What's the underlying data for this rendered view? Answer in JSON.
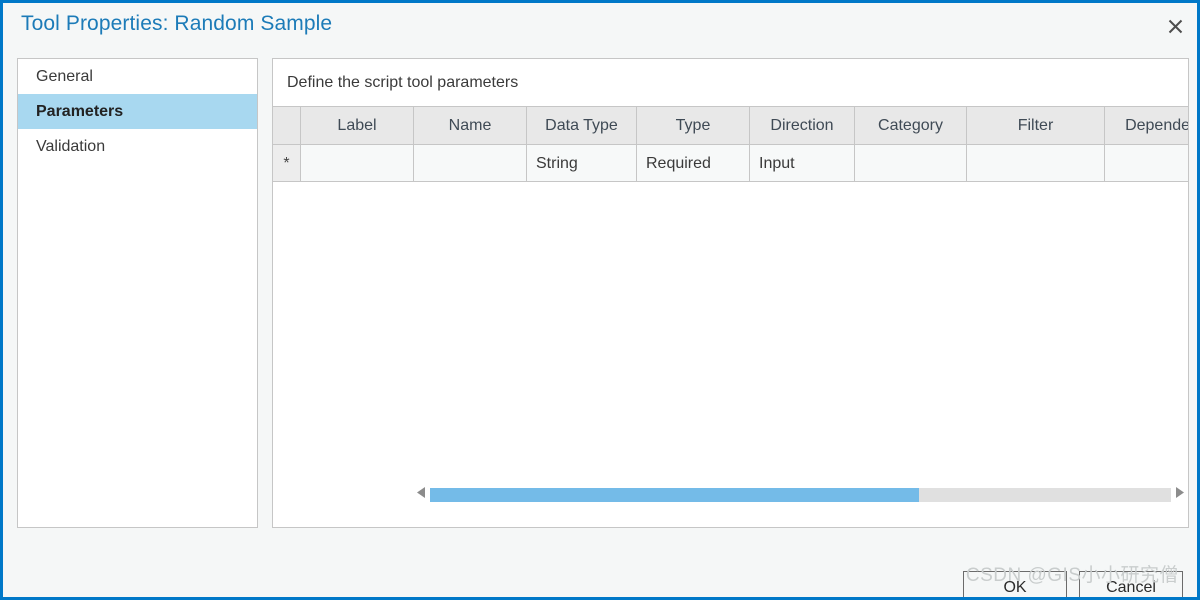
{
  "window": {
    "title": "Tool Properties: Random Sample",
    "close_icon": "close-icon",
    "accent_color": "#0078c8",
    "title_color": "#1c7bb8",
    "background_color": "#f5f7f7"
  },
  "sidebar": {
    "items": [
      {
        "label": "General",
        "selected": false
      },
      {
        "label": "Parameters",
        "selected": true
      },
      {
        "label": "Validation",
        "selected": false
      }
    ],
    "selected_color": "#a8d8f0"
  },
  "main": {
    "header": "Define the script tool parameters",
    "grid": {
      "row_marker_header": "",
      "columns": [
        "Label",
        "Name",
        "Data Type",
        "Type",
        "Direction",
        "Category",
        "Filter",
        "Dependen"
      ],
      "rows": [
        {
          "marker": "*",
          "label": "",
          "name": "",
          "data_type": "String",
          "type": "Required",
          "direction": "Input",
          "category": "",
          "filter": "",
          "dependency": ""
        }
      ]
    },
    "scrollbar": {
      "left_arrow_icon": "triangle-left-icon",
      "right_arrow_icon": "triangle-right-icon",
      "thumb_fraction_percent": 66,
      "thumb_color": "#74bbe8",
      "track_color": "#e0e0e0"
    }
  },
  "footer": {
    "ok_label": "OK",
    "cancel_label": "Cancel"
  },
  "watermark": {
    "text": "CSDN @GIS小小研究僧",
    "color": "#c9cdcd"
  }
}
